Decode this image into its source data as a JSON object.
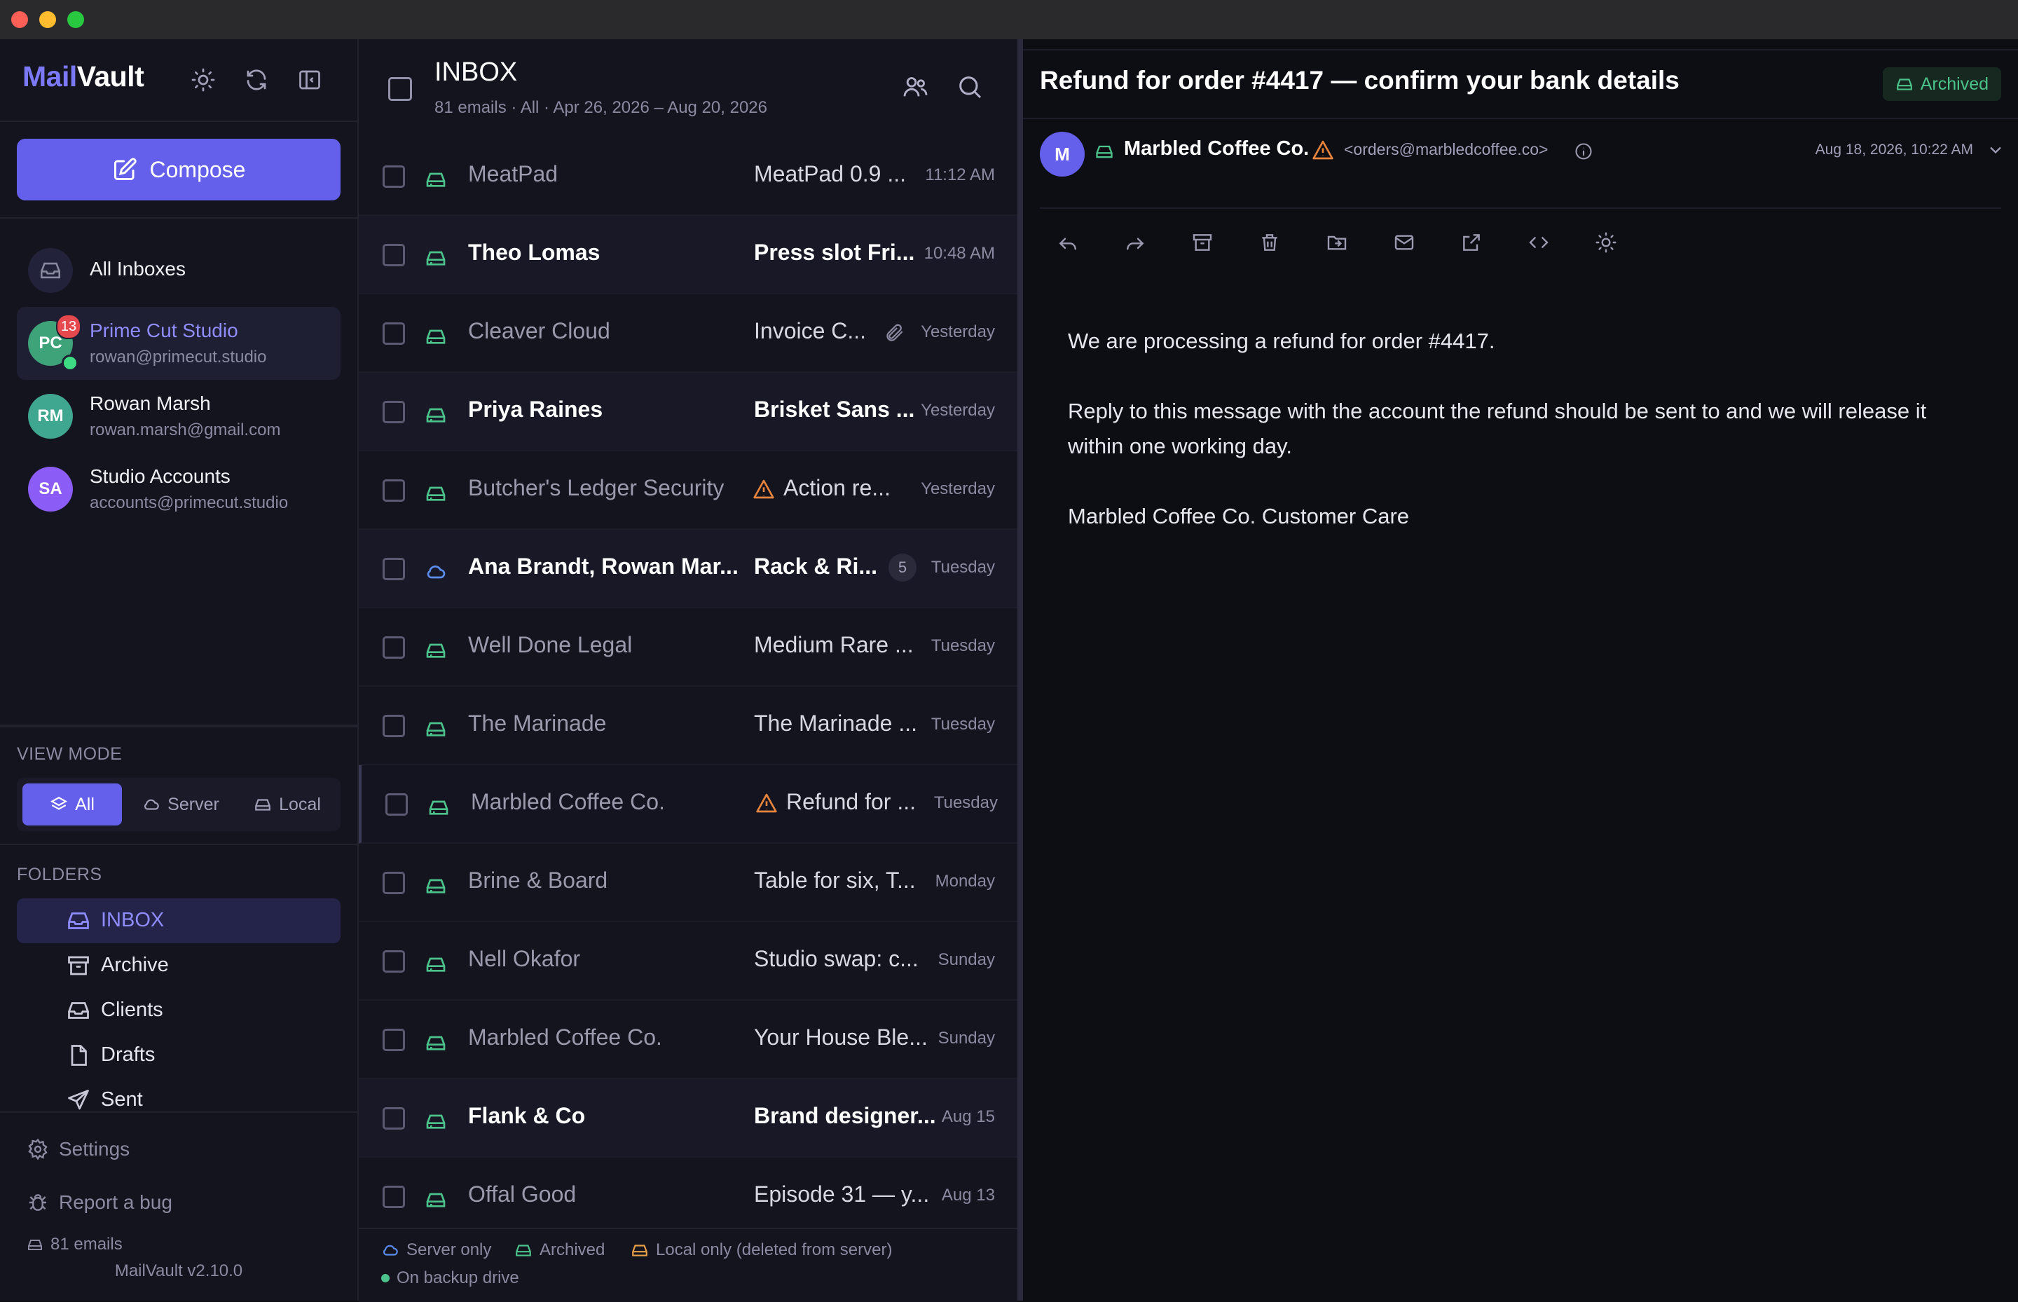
{
  "app": {
    "name_part1": "Mail",
    "name_part2": "Vault",
    "version": "MailVault v2.10.0"
  },
  "sidebar": {
    "compose_label": "Compose",
    "all_inboxes_label": "All Inboxes",
    "accounts": [
      {
        "initials": "PC",
        "name": "Prime Cut Studio",
        "email": "rowan@primecut.studio",
        "badge": "13",
        "color": "#3fa37a",
        "active": true
      },
      {
        "initials": "RM",
        "name": "Rowan Marsh",
        "email": "rowan.marsh@gmail.com",
        "color": "#3fa690"
      },
      {
        "initials": "SA",
        "name": "Studio Accounts",
        "email": "accounts@primecut.studio",
        "color": "#8b5cf6"
      }
    ],
    "view_mode_label": "VIEW MODE",
    "view_modes": [
      "All",
      "Server",
      "Local"
    ],
    "folders_label": "FOLDERS",
    "folders": [
      "INBOX",
      "Archive",
      "Clients",
      "Drafts",
      "Sent"
    ],
    "settings_label": "Settings",
    "report_bug_label": "Report a bug",
    "email_count": "81 emails"
  },
  "list": {
    "title": "INBOX",
    "subtitle": "81 emails · All · Apr 26, 2026 – Aug 20, 2026",
    "rows": [
      {
        "sender": "MeatPad",
        "subject": "MeatPad 0.9 ...",
        "date": "11:12 AM",
        "bold": false
      },
      {
        "sender": "Theo Lomas",
        "subject": "Press slot Fri...",
        "date": "10:48 AM",
        "bold": true
      },
      {
        "sender": "Cleaver Cloud",
        "subject": "Invoice C...",
        "date": "Yesterday",
        "bold": false,
        "attachment": true
      },
      {
        "sender": "Priya Raines",
        "subject": "Brisket Sans ...",
        "date": "Yesterday",
        "bold": true
      },
      {
        "sender": "Butcher's Ledger Security",
        "subject": "Action re...",
        "date": "Yesterday",
        "bold": false,
        "warning": true
      },
      {
        "sender": "Ana Brandt, Rowan Mar...",
        "subject": "Rack & Ri...",
        "date": "Tuesday",
        "bold": true,
        "thread_count": "5",
        "server_only": true
      },
      {
        "sender": "Well Done Legal",
        "subject": "Medium Rare ...",
        "date": "Tuesday",
        "bold": false
      },
      {
        "sender": "The Marinade",
        "subject": "The Marinade ...",
        "date": "Tuesday",
        "bold": false
      },
      {
        "sender": "Marbled Coffee Co.",
        "subject": "Refund for ...",
        "date": "Tuesday",
        "bold": false,
        "warning": true,
        "selected": true
      },
      {
        "sender": "Brine & Board",
        "subject": "Table for six, T...",
        "date": "Monday",
        "bold": false
      },
      {
        "sender": "Nell Okafor",
        "subject": "Studio swap: c...",
        "date": "Sunday",
        "bold": false
      },
      {
        "sender": "Marbled Coffee Co.",
        "subject": "Your House Ble...",
        "date": "Sunday",
        "bold": false
      },
      {
        "sender": "Flank & Co",
        "subject": "Brand designer...",
        "date": "Aug 15",
        "bold": true
      },
      {
        "sender": "Offal Good",
        "subject": "Episode 31 — y...",
        "date": "Aug 13",
        "bold": false
      }
    ],
    "legend": {
      "server_only": "Server only",
      "archived": "Archived",
      "local_only": "Local only (deleted from server)",
      "backup": "On backup drive"
    }
  },
  "reader": {
    "subject": "Refund for order #4417 — confirm your bank details",
    "status": "Archived",
    "sender_initial": "M",
    "sender_name": "Marbled Coffee Co.",
    "sender_email": "<orders@marbledcoffee.co>",
    "date": "Aug 18, 2026, 10:22 AM",
    "body": [
      "We are processing a refund for order #4417.",
      "Reply to this message with the account the refund should be sent to and we will release it within one working day.",
      "Marbled Coffee Co. Customer Care"
    ]
  },
  "colors": {
    "accent": "#6560ec",
    "archived": "#4cc38a",
    "server": "#5b8def",
    "local": "#e8a04a",
    "warning": "#e8843c",
    "badge": "#e5484d"
  }
}
